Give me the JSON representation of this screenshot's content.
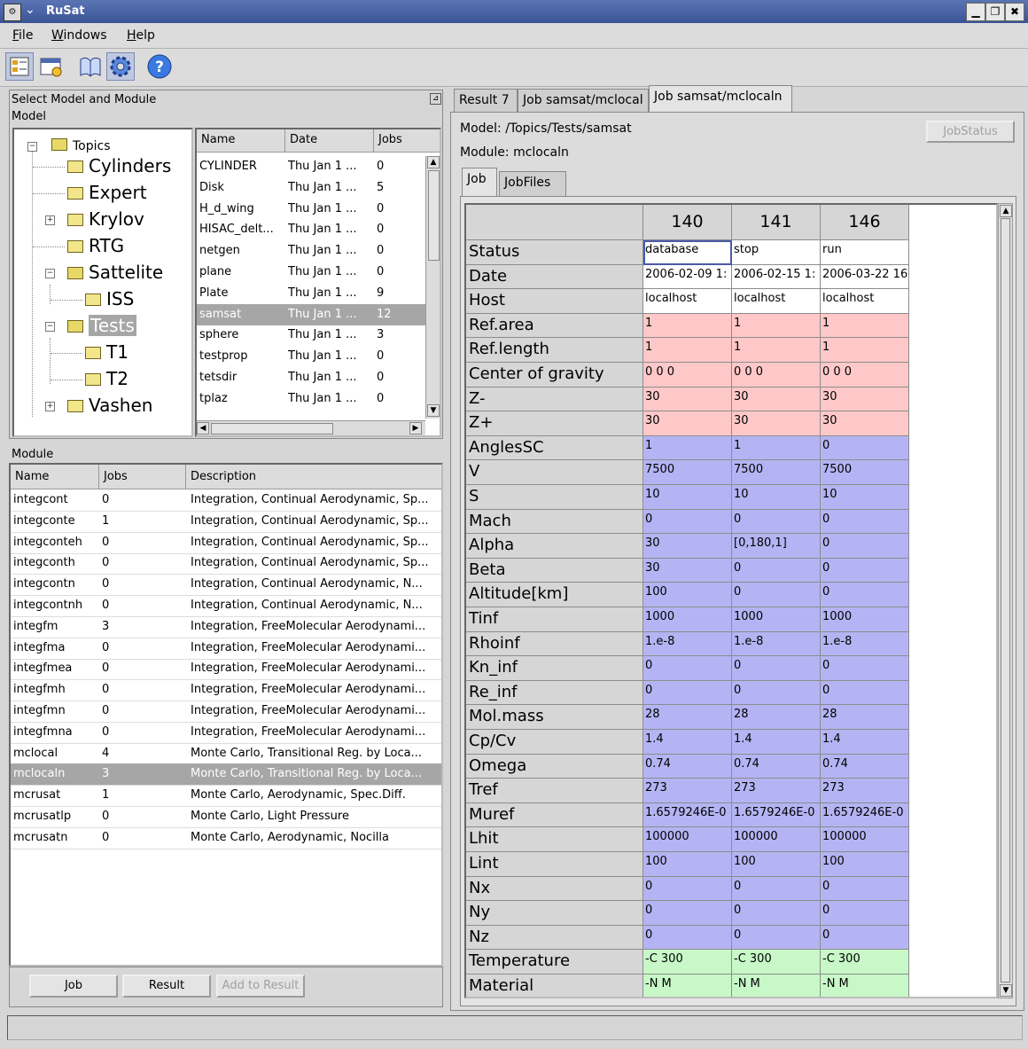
{
  "window": {
    "title": "RuSat",
    "icon": "app-icon",
    "menu_arrow": "❯"
  },
  "window_controls": {
    "minimize": "▁",
    "maximize": "❐",
    "close": "✖"
  },
  "menu": [
    {
      "label": "File",
      "key": "F",
      "rest": "ile"
    },
    {
      "label": "Windows",
      "key": "W",
      "rest": "indows"
    },
    {
      "label": "Help",
      "key": "H",
      "rest": "elp"
    }
  ],
  "toolbar": {
    "icons": [
      "model-browser-icon",
      "window-layout-icon",
      "book-icon",
      "gear-icon",
      "help-icon"
    ],
    "help_glyph": "?"
  },
  "left_top": {
    "title": "Select Model and Module",
    "subtitle": "Model",
    "tree": {
      "root": "Topics",
      "items": [
        {
          "label": "Cylinders",
          "level": 1,
          "expander": ""
        },
        {
          "label": "Expert",
          "level": 1,
          "expander": ""
        },
        {
          "label": "Krylov",
          "level": 1,
          "expander": "+"
        },
        {
          "label": "RTG",
          "level": 1,
          "expander": ""
        },
        {
          "label": "Sattelite",
          "level": 1,
          "expander": "−"
        },
        {
          "label": "ISS",
          "level": 2,
          "expander": ""
        },
        {
          "label": "Tests",
          "level": 1,
          "expander": "−"
        },
        {
          "label": "T1",
          "level": 2,
          "expander": ""
        },
        {
          "label": "T2",
          "level": 2,
          "expander": ""
        },
        {
          "label": "Vashen",
          "level": 1,
          "expander": "+"
        }
      ],
      "root_expander": "−"
    },
    "models_table": {
      "columns": [
        "Name",
        "Date",
        "Jobs"
      ],
      "rows": [
        [
          "CYLINDER",
          "Thu Jan 1 ...",
          "0"
        ],
        [
          "Disk",
          "Thu Jan 1 ...",
          "5"
        ],
        [
          "H_d_wing",
          "Thu Jan 1 ...",
          "0"
        ],
        [
          "HISAC_delt...",
          "Thu Jan 1 ...",
          "0"
        ],
        [
          "netgen",
          "Thu Jan 1 ...",
          "0"
        ],
        [
          "plane",
          "Thu Jan 1 ...",
          "0"
        ],
        [
          "Plate",
          "Thu Jan 1 ...",
          "9"
        ],
        [
          "samsat",
          "Thu Jan 1 ...",
          "12"
        ],
        [
          "sphere",
          "Thu Jan 1 ...",
          "3"
        ],
        [
          "testprop",
          "Thu Jan 1 ...",
          "0"
        ],
        [
          "tetsdir",
          "Thu Jan 1 ...",
          "0"
        ],
        [
          "tplaz",
          "Thu Jan 1 ...",
          "0"
        ]
      ],
      "selected_index": 7
    }
  },
  "module_panel": {
    "title": "Module",
    "columns": [
      "Name",
      "Jobs",
      "Description"
    ],
    "rows": [
      [
        "integcont",
        "0",
        "Integration, Continual Aerodynamic, Sp..."
      ],
      [
        "integconte",
        "1",
        "Integration, Continual Aerodynamic, Sp..."
      ],
      [
        "integconteh",
        "0",
        "Integration, Continual Aerodynamic, Sp..."
      ],
      [
        "integconth",
        "0",
        "Integration, Continual Aerodynamic, Sp..."
      ],
      [
        "integcontn",
        "0",
        "Integration, Continual Aerodynamic, N..."
      ],
      [
        "integcontnh",
        "0",
        "Integration, Continual Aerodynamic, N..."
      ],
      [
        "integfm",
        "3",
        "Integration, FreeMolecular Aerodynami..."
      ],
      [
        "integfma",
        "0",
        "Integration, FreeMolecular Aerodynami..."
      ],
      [
        "integfmea",
        "0",
        "Integration, FreeMolecular Aerodynami..."
      ],
      [
        "integfmh",
        "0",
        "Integration, FreeMolecular Aerodynami..."
      ],
      [
        "integfmn",
        "0",
        "Integration, FreeMolecular Aerodynami..."
      ],
      [
        "integfmna",
        "0",
        "Integration, FreeMolecular Aerodynami..."
      ],
      [
        "mclocal",
        "4",
        "Monte Carlo, Transitional Reg. by Loca..."
      ],
      [
        "mclocaln",
        "3",
        "Monte Carlo, Transitional Reg. by Loca..."
      ],
      [
        "mcrusat",
        "1",
        "Monte Carlo, Aerodynamic, Spec.Diff."
      ],
      [
        "mcrusatlp",
        "0",
        "Monte Carlo, Light Pressure"
      ],
      [
        "mcrusatn",
        "0",
        "Monte Carlo, Aerodynamic, Nocilla"
      ]
    ],
    "selected_index": 13,
    "buttons": {
      "job": "Job",
      "result": "Result",
      "add_to_result": "Add to Result"
    }
  },
  "right": {
    "tabs": [
      "Result 7",
      "Job samsat/mclocal",
      "Job samsat/mclocaln"
    ],
    "active_tab": 2,
    "model_label": "Model: /Topics/Tests/samsat",
    "module_label": "Module: mclocaln",
    "job_status_button": "JobStatus",
    "subtabs": [
      "Job",
      "JobFiles"
    ],
    "active_subtab": 0,
    "job_table": {
      "job_ids": [
        "140",
        "141",
        "146"
      ],
      "colors": {
        "pink": "#ffc8c8",
        "blue": "#b4b4f4",
        "green": "#c8f8c8",
        "white": "#ffffff"
      },
      "rows": [
        {
          "label": "Status",
          "color": "white",
          "values": [
            "database",
            "stop",
            "run"
          ]
        },
        {
          "label": "Date",
          "color": "white",
          "values": [
            "2006-02-09 1:",
            "2006-02-15 1:",
            "2006-03-22 16"
          ]
        },
        {
          "label": "Host",
          "color": "white",
          "values": [
            "localhost",
            "localhost",
            "localhost"
          ]
        },
        {
          "label": "Ref.area",
          "color": "pink",
          "values": [
            "1",
            "1",
            "1"
          ]
        },
        {
          "label": "Ref.length",
          "color": "pink",
          "values": [
            "1",
            "1",
            "1"
          ]
        },
        {
          "label": "Center of gravity",
          "color": "pink",
          "values": [
            "0 0 0",
            "0 0 0",
            "0 0 0"
          ]
        },
        {
          "label": "Z-",
          "color": "pink",
          "values": [
            "30",
            "30",
            "30"
          ]
        },
        {
          "label": "Z+",
          "color": "pink",
          "values": [
            "30",
            "30",
            "30"
          ]
        },
        {
          "label": "AnglesSC",
          "color": "blue",
          "values": [
            "1",
            "1",
            "0"
          ]
        },
        {
          "label": "V",
          "color": "blue",
          "values": [
            "7500",
            "7500",
            "7500"
          ]
        },
        {
          "label": "S",
          "color": "blue",
          "values": [
            "10",
            "10",
            "10"
          ]
        },
        {
          "label": "Mach",
          "color": "blue",
          "values": [
            "0",
            "0",
            "0"
          ]
        },
        {
          "label": "Alpha",
          "color": "blue",
          "values": [
            "30",
            "[0,180,1]",
            "0"
          ]
        },
        {
          "label": "Beta",
          "color": "blue",
          "values": [
            "30",
            "0",
            "0"
          ]
        },
        {
          "label": "Altitude[km]",
          "color": "blue",
          "values": [
            "100",
            "0",
            "0"
          ]
        },
        {
          "label": "Tinf",
          "color": "blue",
          "values": [
            "1000",
            "1000",
            "1000"
          ]
        },
        {
          "label": "Rhoinf",
          "color": "blue",
          "values": [
            "1.e-8",
            "1.e-8",
            "1.e-8"
          ]
        },
        {
          "label": "Kn_inf",
          "color": "blue",
          "values": [
            "0",
            "0",
            "0"
          ]
        },
        {
          "label": "Re_inf",
          "color": "blue",
          "values": [
            "0",
            "0",
            "0"
          ]
        },
        {
          "label": "Mol.mass",
          "color": "blue",
          "values": [
            "28",
            "28",
            "28"
          ]
        },
        {
          "label": "Cp/Cv",
          "color": "blue",
          "values": [
            "1.4",
            "1.4",
            "1.4"
          ]
        },
        {
          "label": "Omega",
          "color": "blue",
          "values": [
            "0.74",
            "0.74",
            "0.74"
          ]
        },
        {
          "label": "Tref",
          "color": "blue",
          "values": [
            "273",
            "273",
            "273"
          ]
        },
        {
          "label": "Muref",
          "color": "blue",
          "values": [
            "1.6579246E-0",
            "1.6579246E-0",
            "1.6579246E-0"
          ]
        },
        {
          "label": "Lhit",
          "color": "blue",
          "values": [
            "100000",
            "100000",
            "100000"
          ]
        },
        {
          "label": "Lint",
          "color": "blue",
          "values": [
            "100",
            "100",
            "100"
          ]
        },
        {
          "label": "Nx",
          "color": "blue",
          "values": [
            "0",
            "0",
            "0"
          ]
        },
        {
          "label": "Ny",
          "color": "blue",
          "values": [
            "0",
            "0",
            "0"
          ]
        },
        {
          "label": "Nz",
          "color": "blue",
          "values": [
            "0",
            "0",
            "0"
          ]
        },
        {
          "label": "Temperature",
          "color": "green",
          "values": [
            "-C 300",
            "-C 300",
            "-C 300"
          ]
        },
        {
          "label": "Material",
          "color": "green",
          "values": [
            "-N M",
            "-N M",
            "-N M"
          ]
        }
      ]
    }
  },
  "scroll_glyphs": {
    "up": "▲",
    "down": "▼",
    "left": "◀",
    "right": "▶"
  }
}
